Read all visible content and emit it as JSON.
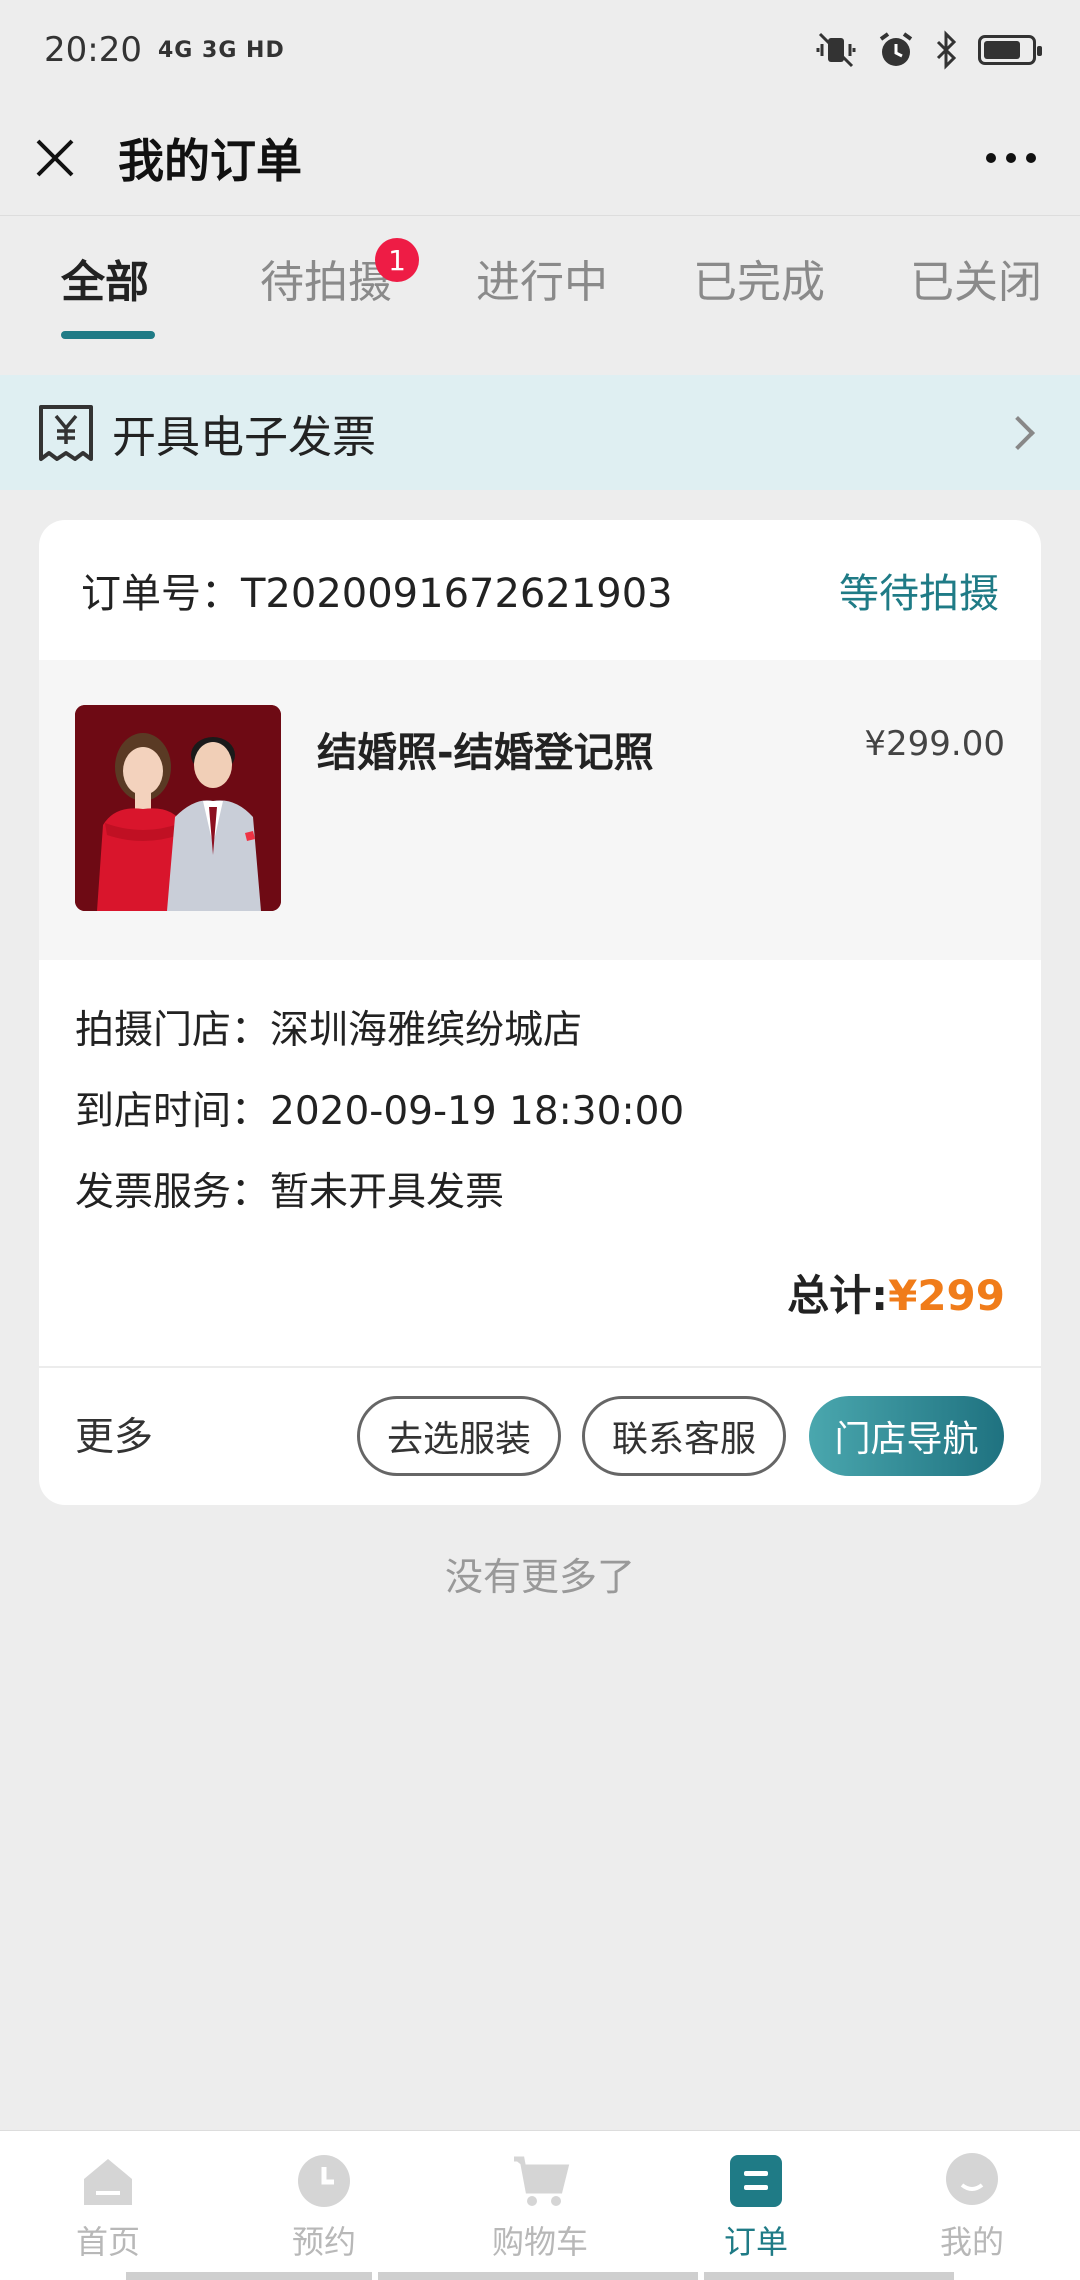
{
  "status_bar": {
    "time": "20:20",
    "network": "4G 3G HD"
  },
  "header": {
    "title": "我的订单"
  },
  "tabs": [
    {
      "label": "全部",
      "active": true
    },
    {
      "label": "待拍摄",
      "badge": "1"
    },
    {
      "label": "进行中"
    },
    {
      "label": "已完成"
    },
    {
      "label": "已关闭"
    }
  ],
  "invoice_banner": {
    "label": "开具电子发票"
  },
  "order": {
    "order_no": "订单号：T2020091672621903",
    "status": "等待拍摄",
    "product_name": "结婚照-结婚登记照",
    "product_price": "¥299.00",
    "store": "拍摄门店：深圳海雅缤纷城店",
    "arrival_time": "到店时间：2020-09-19 18:30:00",
    "invoice_service": "发票服务：暂未开具发票",
    "total_label": "总计:",
    "total_amount": "¥299",
    "more": "更多",
    "buttons": {
      "choose_outfit": "去选服装",
      "contact": "联系客服",
      "navigate": "门店导航"
    }
  },
  "footer_note": "没有更多了",
  "bottom_nav": [
    {
      "label": "首页",
      "icon": "home-icon"
    },
    {
      "label": "预约",
      "icon": "clock-icon"
    },
    {
      "label": "购物车",
      "icon": "cart-icon"
    },
    {
      "label": "订单",
      "icon": "order-icon",
      "active": true
    },
    {
      "label": "我的",
      "icon": "profile-icon"
    }
  ],
  "colors": {
    "accent": "#1f7b86",
    "price": "#f07c1a",
    "badge": "#ee1c45"
  }
}
